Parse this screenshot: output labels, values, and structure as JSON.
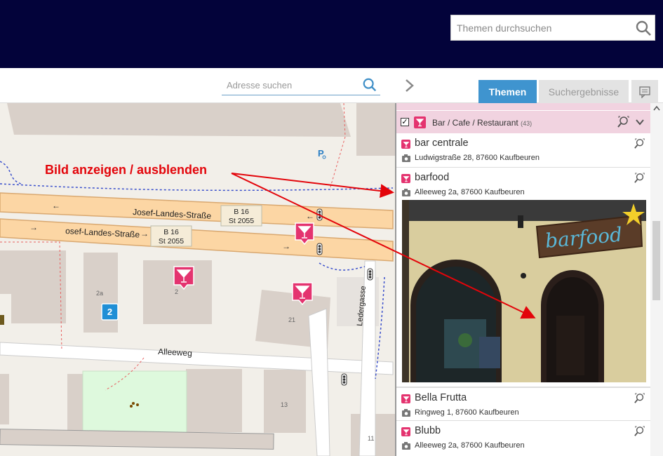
{
  "header": {
    "theme_search_placeholder": "Themen durchsuchen"
  },
  "toolbar": {
    "address_placeholder": "Adresse suchen",
    "tabs": [
      "Themen",
      "Suchergebnisse"
    ]
  },
  "annotation": "Bild anzeigen / ausblenden",
  "map": {
    "streets": [
      "Josef-Landes-Straße",
      "osef-Landes-Straße",
      "Alleeweg",
      "Ledergasse"
    ],
    "shields": [
      {
        "line1": "B 16",
        "line2": "St 2055"
      },
      {
        "line1": "B 16",
        "line2": "St 2055"
      }
    ],
    "house_numbers": [
      "2a",
      "2",
      "21",
      "13",
      "11"
    ],
    "cluster_count": "2"
  },
  "category": {
    "label": "Bar / Cafe / Restaurant",
    "count": "(43)",
    "checked": true
  },
  "items": [
    {
      "name": "bar centrale",
      "address": "Ludwigstraße 28, 87600 Kaufbeuren"
    },
    {
      "name": "barfood",
      "address": "Alleeweg 2a, 87600 Kaufbeuren",
      "photo_sign": "barfood"
    },
    {
      "name": "Bella Frutta",
      "address": "Ringweg 1, 87600 Kaufbeuren"
    },
    {
      "name": "Blubb",
      "address": "Alleeweg 2a, 87600 Kaufbeuren"
    }
  ],
  "colors": {
    "header_bg": "#03033a",
    "accent": "#3f94cf",
    "category_bg": "#f1d3e0",
    "poi_pink": "#e4336f",
    "annotation_red": "#e3040a"
  },
  "icons": [
    "search-icon",
    "chevron-right-icon",
    "comment-icon",
    "cocktail-icon",
    "camera-icon",
    "zoom-to-icon",
    "chevron-down-icon",
    "parking-icon"
  ]
}
